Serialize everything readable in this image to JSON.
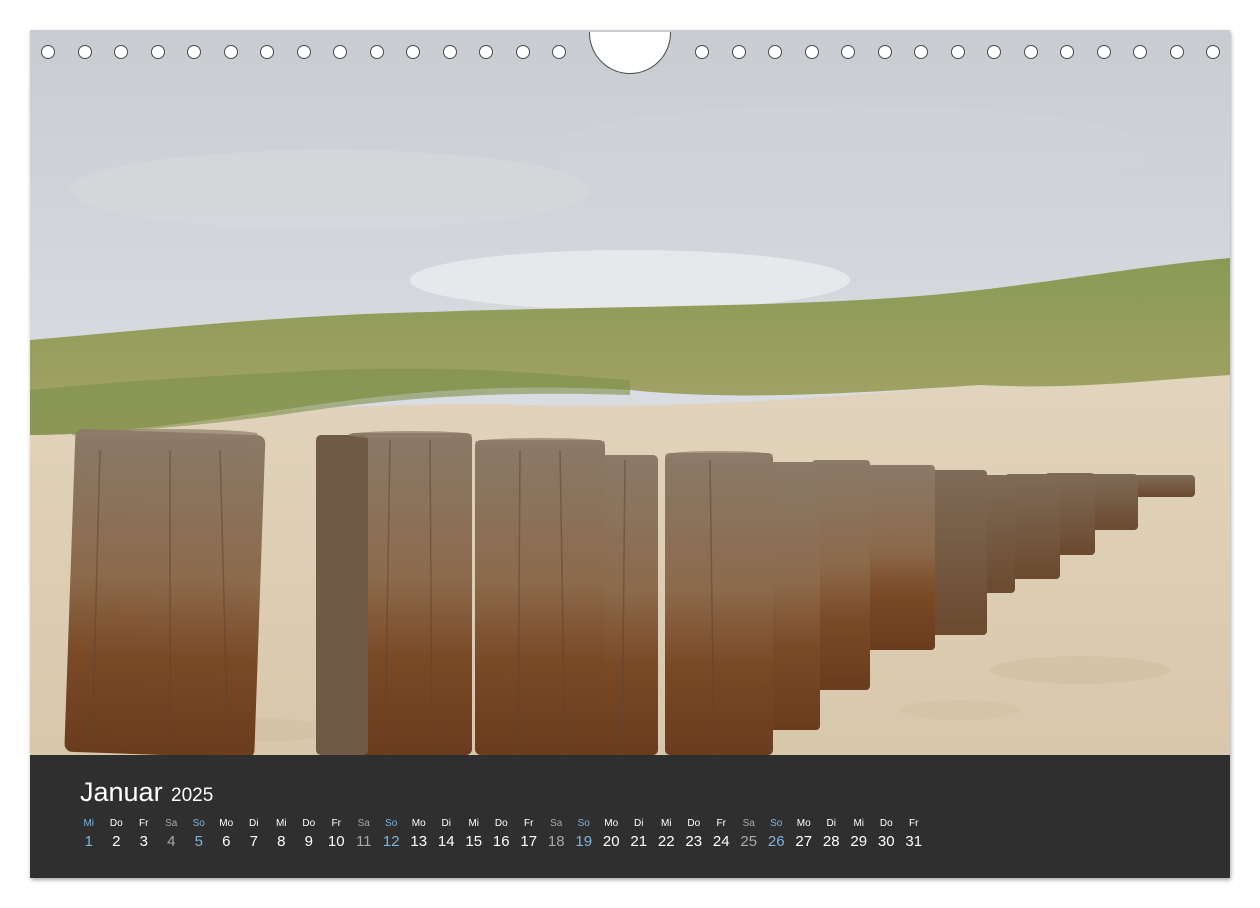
{
  "calendar": {
    "month": "Januar",
    "year": "2025",
    "colors": {
      "band": "#2f2f2f",
      "text": "#ffffff",
      "sunday": "#7fb4dc",
      "saturday": "#a9a9a9"
    },
    "days": [
      {
        "dow": "Mi",
        "num": "1",
        "type": "first"
      },
      {
        "dow": "Do",
        "num": "2",
        "type": "week"
      },
      {
        "dow": "Fr",
        "num": "3",
        "type": "week"
      },
      {
        "dow": "Sa",
        "num": "4",
        "type": "sat"
      },
      {
        "dow": "So",
        "num": "5",
        "type": "sun"
      },
      {
        "dow": "Mo",
        "num": "6",
        "type": "week"
      },
      {
        "dow": "Di",
        "num": "7",
        "type": "week"
      },
      {
        "dow": "Mi",
        "num": "8",
        "type": "week"
      },
      {
        "dow": "Do",
        "num": "9",
        "type": "week"
      },
      {
        "dow": "Fr",
        "num": "10",
        "type": "week"
      },
      {
        "dow": "Sa",
        "num": "11",
        "type": "sat"
      },
      {
        "dow": "So",
        "num": "12",
        "type": "sun"
      },
      {
        "dow": "Mo",
        "num": "13",
        "type": "week"
      },
      {
        "dow": "Di",
        "num": "14",
        "type": "week"
      },
      {
        "dow": "Mi",
        "num": "15",
        "type": "week"
      },
      {
        "dow": "Do",
        "num": "16",
        "type": "week"
      },
      {
        "dow": "Fr",
        "num": "17",
        "type": "week"
      },
      {
        "dow": "Sa",
        "num": "18",
        "type": "sat"
      },
      {
        "dow": "So",
        "num": "19",
        "type": "sun"
      },
      {
        "dow": "Mo",
        "num": "20",
        "type": "week"
      },
      {
        "dow": "Di",
        "num": "21",
        "type": "week"
      },
      {
        "dow": "Mi",
        "num": "22",
        "type": "week"
      },
      {
        "dow": "Do",
        "num": "23",
        "type": "week"
      },
      {
        "dow": "Fr",
        "num": "24",
        "type": "week"
      },
      {
        "dow": "Sa",
        "num": "25",
        "type": "sat"
      },
      {
        "dow": "So",
        "num": "26",
        "type": "sun"
      },
      {
        "dow": "Mo",
        "num": "27",
        "type": "week"
      },
      {
        "dow": "Di",
        "num": "28",
        "type": "week"
      },
      {
        "dow": "Mi",
        "num": "29",
        "type": "week"
      },
      {
        "dow": "Do",
        "num": "30",
        "type": "week"
      },
      {
        "dow": "Fr",
        "num": "31",
        "type": "week"
      }
    ]
  },
  "binding": {
    "hole_count_left": 15,
    "hole_count_right": 15
  }
}
